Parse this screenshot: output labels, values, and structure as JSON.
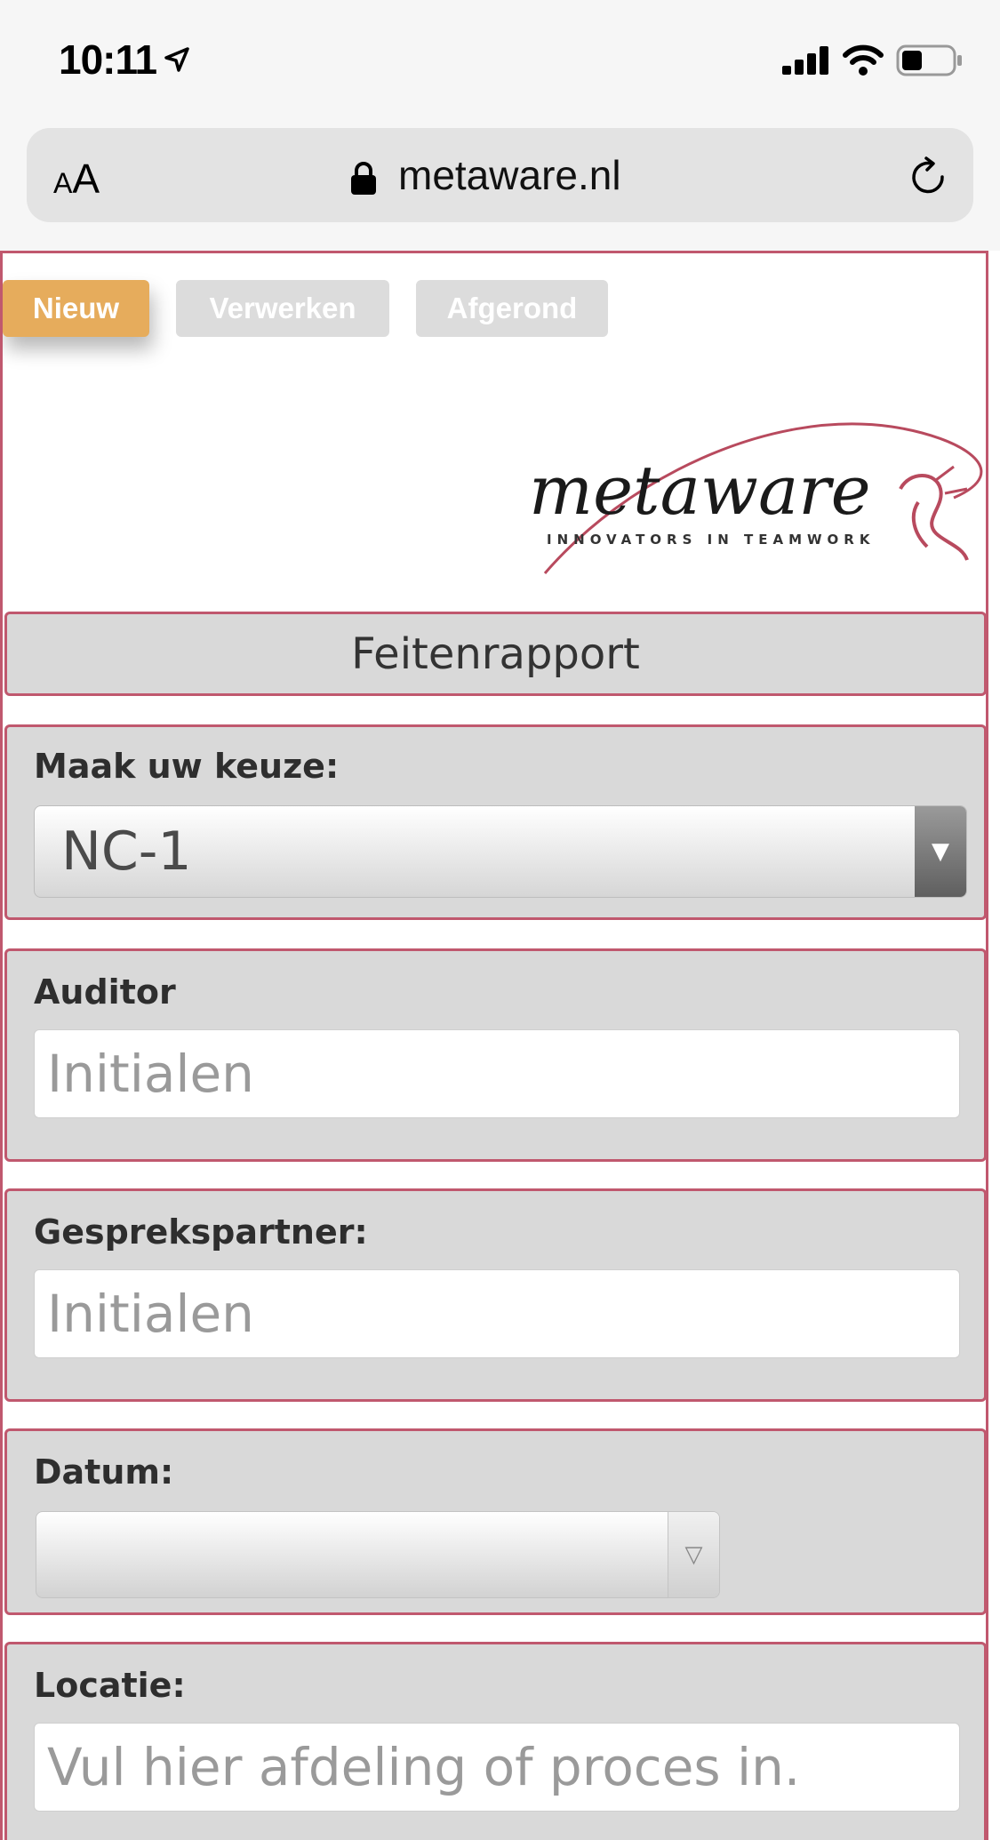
{
  "status_bar": {
    "time": "10:11"
  },
  "browser": {
    "text_size_small": "A",
    "text_size_big": "A",
    "url": "metaware.nl"
  },
  "tabs": [
    {
      "label": "Nieuw",
      "active": true
    },
    {
      "label": "Verwerken",
      "active": false
    },
    {
      "label": "Afgerond",
      "active": false
    }
  ],
  "logo": {
    "brand": "metaware",
    "tagline": "INNOVATORS IN TEAMWORK"
  },
  "form": {
    "title": "Feitenrapport",
    "choice": {
      "label": "Maak uw keuze:",
      "selected": "NC-1"
    },
    "auditor": {
      "label": "Auditor",
      "placeholder": "Initialen"
    },
    "partner": {
      "label": "Gesprekspartner:",
      "placeholder": "Initialen"
    },
    "date": {
      "label": "Datum:",
      "value": ""
    },
    "location": {
      "label": "Locatie:",
      "placeholder": "Vul hier afdeling of proces in."
    }
  },
  "colors": {
    "accent": "#e6ac5c",
    "border": "#c0586e",
    "panel": "#d9d9d9"
  }
}
